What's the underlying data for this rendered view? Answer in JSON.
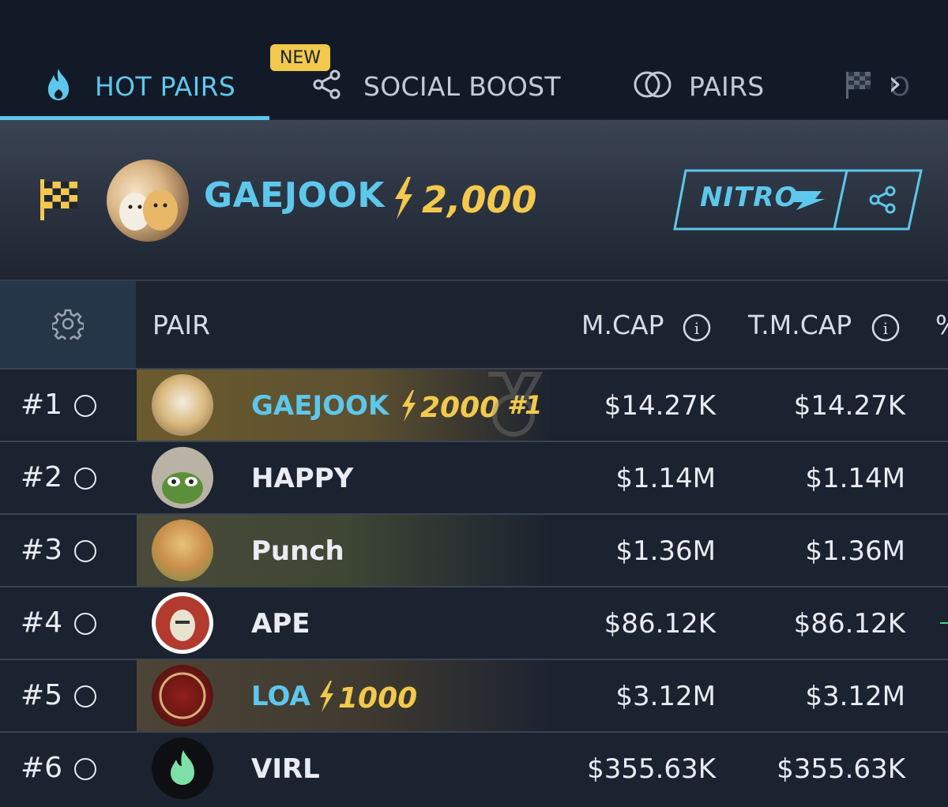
{
  "tabs": {
    "hot_pairs": "HOT PAIRS",
    "social_boost": "SOCIAL BOOST",
    "new_badge": "NEW",
    "pairs": "PAIRS",
    "partial": "O"
  },
  "banner": {
    "token": "GAEJOOK",
    "boost_amount": "2,000",
    "nitro_label": "NITRO"
  },
  "table": {
    "headers": {
      "pair": "PAIR",
      "mcap": "M.CAP",
      "tmcap": "T.M.CAP",
      "pct": "%"
    },
    "rows": [
      {
        "rank": "#1",
        "name": "GAEJOOK",
        "boost": "2000",
        "badge": "#1",
        "mcap": "$14.27K",
        "tmcap": "$14.27K"
      },
      {
        "rank": "#2",
        "name": "HAPPY",
        "mcap": "$1.14M",
        "tmcap": "$1.14M"
      },
      {
        "rank": "#3",
        "name": "Punch",
        "mcap": "$1.36M",
        "tmcap": "$1.36M"
      },
      {
        "rank": "#4",
        "name": "APE",
        "mcap": "$86.12K",
        "tmcap": "$86.12K"
      },
      {
        "rank": "#5",
        "name": "LOA",
        "boost": "1000",
        "mcap": "$3.12M",
        "tmcap": "$3.12M"
      },
      {
        "rank": "#6",
        "name": "VIRL",
        "mcap": "$355.63K",
        "tmcap": "$355.63K"
      }
    ]
  },
  "colors": {
    "accent": "#5ec7ec",
    "gold": "#f2c94c",
    "background": "#1b2230",
    "header_bg": "#131a27"
  },
  "icons": {
    "hot": "flame-icon",
    "social": "share-icon",
    "pairs": "overlapping-circles-icon",
    "flag": "checkered-flag-icon",
    "settings": "gear-icon",
    "info": "info-icon",
    "boost": "lightning-bolt-icon"
  }
}
